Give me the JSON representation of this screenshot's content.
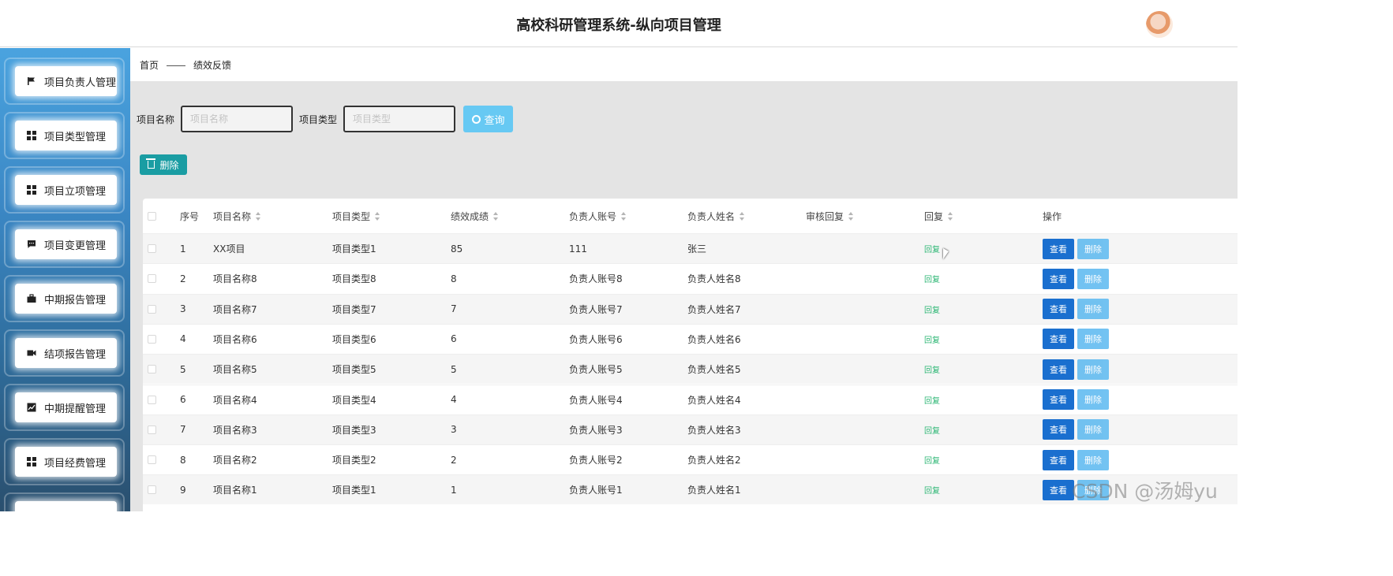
{
  "header": {
    "title": "高校科研管理系统-纵向项目管理"
  },
  "sidebar": {
    "items": [
      {
        "label": "项目负责人管理",
        "icon": "flag-icon"
      },
      {
        "label": "项目类型管理",
        "icon": "grid-icon"
      },
      {
        "label": "项目立项管理",
        "icon": "grid-icon"
      },
      {
        "label": "项目变更管理",
        "icon": "message-icon"
      },
      {
        "label": "中期报告管理",
        "icon": "briefcase-icon"
      },
      {
        "label": "结项报告管理",
        "icon": "video-icon"
      },
      {
        "label": "中期提醒管理",
        "icon": "chart-icon"
      },
      {
        "label": "项目经费管理",
        "icon": "grid-icon"
      }
    ]
  },
  "breadcrumb": {
    "home": "首页",
    "current": "绩效反馈"
  },
  "search": {
    "name_label": "项目名称",
    "name_placeholder": "项目名称",
    "type_label": "项目类型",
    "type_placeholder": "项目类型",
    "query_label": "查询"
  },
  "toolbar": {
    "delete_label": "删除"
  },
  "table": {
    "columns": [
      "序号",
      "项目名称",
      "项目类型",
      "绩效成绩",
      "负责人账号",
      "负责人姓名",
      "审核回复",
      "回复",
      "操作"
    ],
    "rows": [
      {
        "no": "1",
        "name": "XX项目",
        "type": "项目类型1",
        "score": "85",
        "account": "111",
        "person": "张三",
        "review": "",
        "reply": "回复"
      },
      {
        "no": "2",
        "name": "项目名称8",
        "type": "项目类型8",
        "score": "8",
        "account": "负责人账号8",
        "person": "负责人姓名8",
        "review": "",
        "reply": "回复"
      },
      {
        "no": "3",
        "name": "项目名称7",
        "type": "项目类型7",
        "score": "7",
        "account": "负责人账号7",
        "person": "负责人姓名7",
        "review": "",
        "reply": "回复"
      },
      {
        "no": "4",
        "name": "项目名称6",
        "type": "项目类型6",
        "score": "6",
        "account": "负责人账号6",
        "person": "负责人姓名6",
        "review": "",
        "reply": "回复"
      },
      {
        "no": "5",
        "name": "项目名称5",
        "type": "项目类型5",
        "score": "5",
        "account": "负责人账号5",
        "person": "负责人姓名5",
        "review": "",
        "reply": "回复"
      },
      {
        "no": "6",
        "name": "项目名称4",
        "type": "项目类型4",
        "score": "4",
        "account": "负责人账号4",
        "person": "负责人姓名4",
        "review": "",
        "reply": "回复"
      },
      {
        "no": "7",
        "name": "项目名称3",
        "type": "项目类型3",
        "score": "3",
        "account": "负责人账号3",
        "person": "负责人姓名3",
        "review": "",
        "reply": "回复"
      },
      {
        "no": "8",
        "name": "项目名称2",
        "type": "项目类型2",
        "score": "2",
        "account": "负责人账号2",
        "person": "负责人姓名2",
        "review": "",
        "reply": "回复"
      },
      {
        "no": "9",
        "name": "项目名称1",
        "type": "项目类型1",
        "score": "1",
        "account": "负责人账号1",
        "person": "负责人姓名1",
        "review": "",
        "reply": "回复"
      }
    ],
    "view_label": "查看",
    "delete_label": "删除"
  },
  "watermark": "CSDN @汤姆yu",
  "colors": {
    "primary": "#1a6fcf",
    "teal": "#1a9da3",
    "query": "#67c9f3",
    "reply": "#2bb673"
  }
}
